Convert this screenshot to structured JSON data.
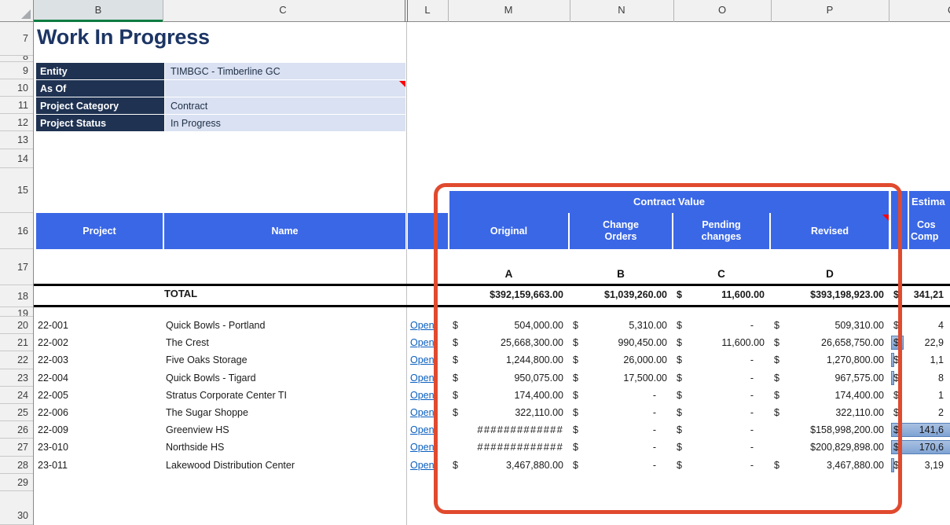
{
  "title": "Work In Progress",
  "column_headers": [
    "B",
    "C",
    "L",
    "M",
    "N",
    "O",
    "P",
    "Q"
  ],
  "row_headers": [
    "7",
    "8",
    "9",
    "10",
    "11",
    "12",
    "13",
    "14",
    "15",
    "16",
    "17",
    "18",
    "19",
    "20",
    "21",
    "22",
    "23",
    "24",
    "25",
    "26",
    "27",
    "28",
    "29",
    "30"
  ],
  "info": {
    "rows": [
      {
        "label": "Entity",
        "value": "TIMBGC - Timberline GC",
        "comment": false
      },
      {
        "label": "As Of",
        "value": "",
        "comment": true
      },
      {
        "label": "Project Category",
        "value": "Contract",
        "comment": false
      },
      {
        "label": "Project Status",
        "value": "In Progress",
        "comment": false
      }
    ]
  },
  "table": {
    "groups": {
      "contract": "Contract Value",
      "estimated_partial": "Estima"
    },
    "headers": {
      "project": "Project",
      "name": "Name",
      "original": "Original",
      "change_orders": "Change Orders",
      "pending_changes": "Pending changes",
      "revised": "Revised",
      "est_lines": [
        "Cos",
        "Comp"
      ]
    },
    "letters": [
      "A",
      "B",
      "C",
      "D"
    ],
    "link_label": "Open",
    "total": {
      "label": "TOTAL",
      "m": [
        "",
        "$392,159,663.00"
      ],
      "n": [
        "",
        "$1,039,260.00"
      ],
      "o": [
        "$",
        "11,600.00"
      ],
      "p": [
        "",
        "$393,198,923.00"
      ],
      "q": [
        "$",
        "341,21"
      ]
    },
    "rows": [
      {
        "project": "22-001",
        "name": "Quick Bowls - Portland",
        "m": [
          "$",
          "504,000.00"
        ],
        "n": [
          "$",
          "5,310.00"
        ],
        "o": [
          "$",
          "-"
        ],
        "p": [
          "$",
          "509,310.00"
        ],
        "q": [
          "$",
          "4"
        ],
        "bar": 0
      },
      {
        "project": "22-002",
        "name": "The Crest",
        "m": [
          "$",
          "25,668,300.00"
        ],
        "n": [
          "$",
          "990,450.00"
        ],
        "o": [
          "$",
          "11,600.00"
        ],
        "p": [
          "$",
          "26,658,750.00"
        ],
        "q": [
          "$",
          "22,9"
        ],
        "bar": 16
      },
      {
        "project": "22-003",
        "name": "Five Oaks Storage",
        "m": [
          "$",
          "1,244,800.00"
        ],
        "n": [
          "$",
          "26,000.00"
        ],
        "o": [
          "$",
          "-"
        ],
        "p": [
          "$",
          "1,270,800.00"
        ],
        "q": [
          "$",
          "1,1"
        ],
        "bar": 4
      },
      {
        "project": "22-004",
        "name": "Quick Bowls - Tigard",
        "m": [
          "$",
          "950,075.00"
        ],
        "n": [
          "$",
          "17,500.00"
        ],
        "o": [
          "$",
          "-"
        ],
        "p": [
          "$",
          "967,575.00"
        ],
        "q": [
          "$",
          "8"
        ],
        "bar": 4
      },
      {
        "project": "22-005",
        "name": "Stratus Corporate Center TI",
        "m": [
          "$",
          "174,400.00"
        ],
        "n": [
          "$",
          "-"
        ],
        "o": [
          "$",
          "-"
        ],
        "p": [
          "$",
          "174,400.00"
        ],
        "q": [
          "$",
          "1"
        ],
        "bar": 0
      },
      {
        "project": "22-006",
        "name": "The Sugar Shoppe",
        "m": [
          "$",
          "322,110.00"
        ],
        "n": [
          "$",
          "-"
        ],
        "o": [
          "$",
          "-"
        ],
        "p": [
          "$",
          "322,110.00"
        ],
        "q": [
          "$",
          "2"
        ],
        "bar": 0
      },
      {
        "project": "22-009",
        "name": "Greenview HS",
        "m": [
          "",
          "#############"
        ],
        "n": [
          "$",
          "-"
        ],
        "o": [
          "$",
          "-"
        ],
        "p": [
          "",
          "$158,998,200.00"
        ],
        "q": [
          "$",
          "141,6"
        ],
        "bar": 76
      },
      {
        "project": "23-010",
        "name": "Northside HS",
        "m": [
          "",
          "#############"
        ],
        "n": [
          "$",
          "-"
        ],
        "o": [
          "$",
          "-"
        ],
        "p": [
          "",
          "$200,829,898.00"
        ],
        "q": [
          "$",
          "170,6"
        ],
        "bar": 76
      },
      {
        "project": "23-011",
        "name": "Lakewood Distribution Center",
        "m": [
          "$",
          "3,467,880.00"
        ],
        "n": [
          "$",
          "-"
        ],
        "o": [
          "$",
          "-"
        ],
        "p": [
          "$",
          "3,467,880.00"
        ],
        "q": [
          "$",
          "3,19"
        ],
        "bar": 4
      }
    ]
  },
  "colors": {
    "header_blue": "#3A67E6",
    "label_navy": "#1F3252",
    "value_light_blue": "#D9E1F2",
    "annotation_red": "#E04A2E",
    "hyperlink_blue": "#0B5FBF",
    "selection_green": "#0E7C41",
    "databar_blue": "#7FA3D4",
    "comment_marker_red": "#FF0000"
  }
}
